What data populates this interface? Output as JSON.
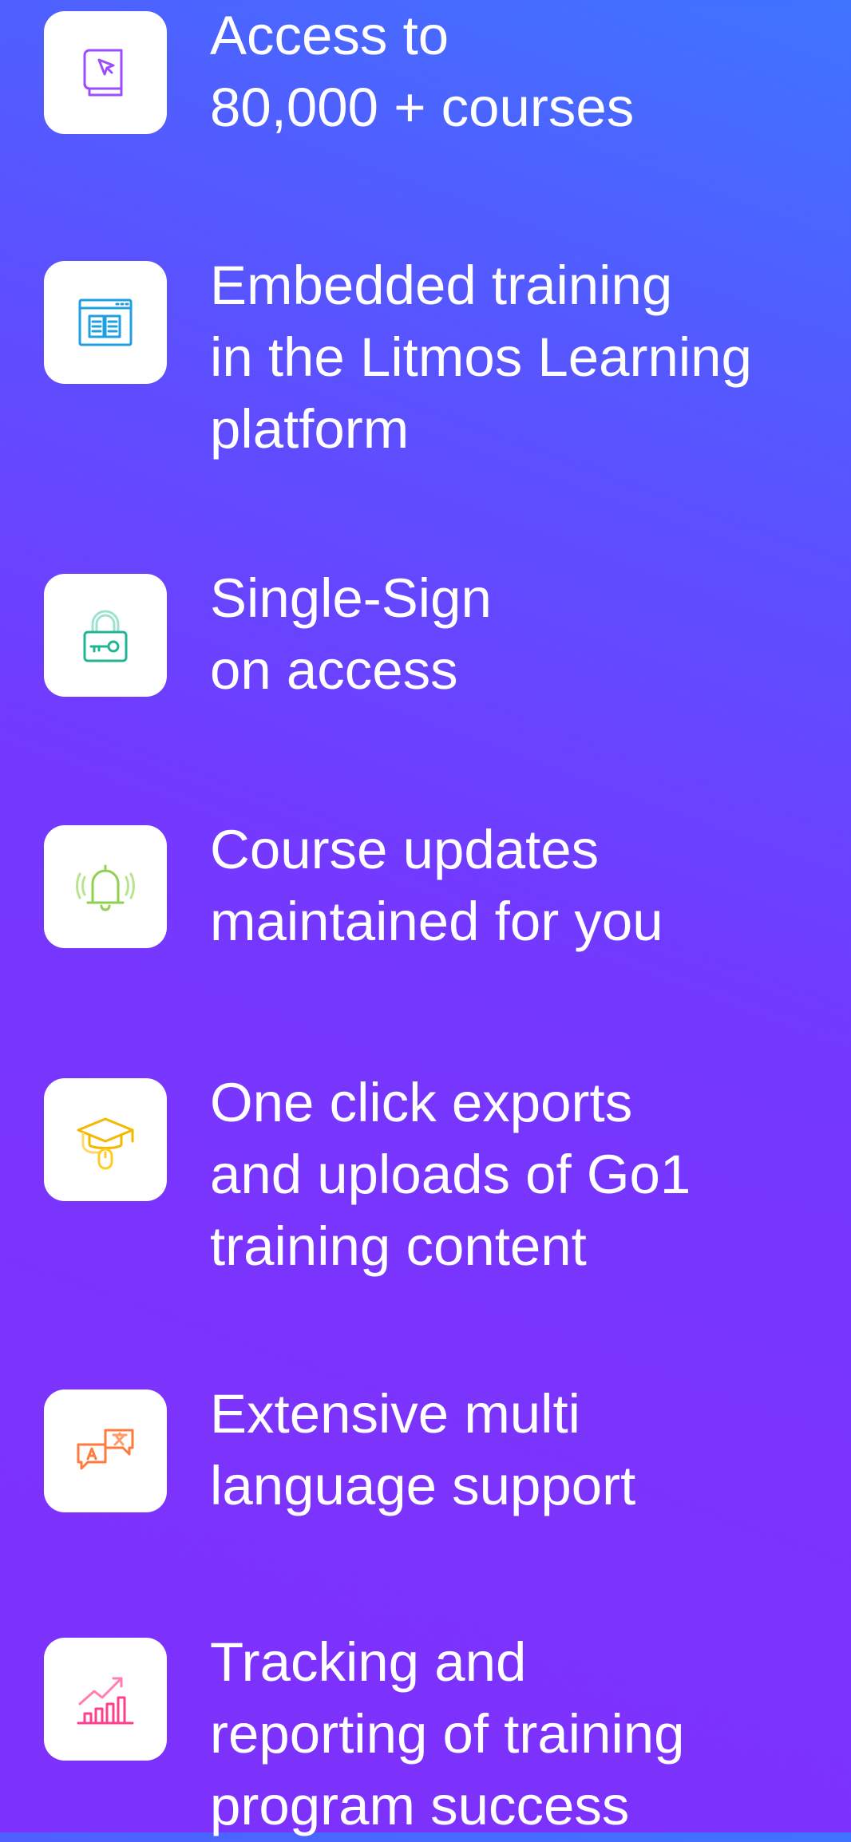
{
  "features": [
    {
      "icon": "book-cursor-icon",
      "color": "#9b4dff",
      "lines": [
        "Access to",
        "80,000 + courses"
      ]
    },
    {
      "icon": "browser-book-icon",
      "color": "#1f9fe0",
      "lines": [
        "Embedded training",
        "in the Litmos Learning",
        "platform"
      ]
    },
    {
      "icon": "lock-key-icon",
      "color": "#1fb594",
      "lines": [
        "Single-Sign",
        "on access"
      ]
    },
    {
      "icon": "bell-icon",
      "color": "#8fd14f",
      "lines": [
        "Course updates",
        "maintained for you"
      ]
    },
    {
      "icon": "graduation-mouse-icon",
      "color": "#ffcc1f",
      "lines": [
        "One click exports",
        "and uploads of Go1",
        "training content"
      ]
    },
    {
      "icon": "translate-bubbles-icon",
      "color": "#ff7a3d",
      "lines": [
        "Extensive multi",
        "language support"
      ]
    },
    {
      "icon": "growth-chart-icon",
      "color": "#ff3f8e",
      "lines": [
        "Tracking and",
        "reporting of training",
        "program success"
      ]
    }
  ]
}
